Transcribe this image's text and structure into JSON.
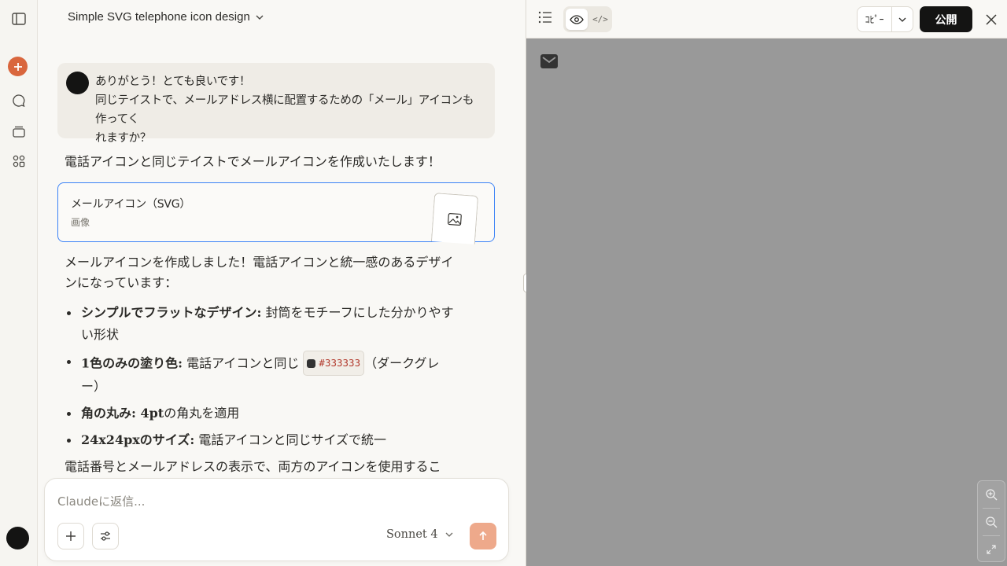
{
  "rail": {
    "icons": [
      "sidebar-toggle-icon",
      "new-chat-icon",
      "chats-icon",
      "projects-icon",
      "artifacts-icon"
    ]
  },
  "chat": {
    "title": "Simple SVG telephone icon design",
    "user_message": "ありがとう！とても良いです！\n同じテイストで、メールアドレス横に配置するための「メール」アイコンも作ってく\nれますか？",
    "assistant_intro": "電話アイコンと同じテイストでメールアイコンを作成いたします！",
    "artifact": {
      "title": "メールアイコン（SVG）",
      "subtitle": "画像"
    },
    "assistant_body_line1": "メールアイコンを作成しました！電話アイコンと統一感のあるデザイ",
    "assistant_body_line2": "ンになっています：",
    "bullets": [
      {
        "bold": "シンプルでフラットなデザイン:",
        "text": " 封筒をモチーフにした分かりやす",
        "text2": "い形状"
      },
      {
        "bold": "1色のみの塗り色:",
        "text": " 電話アイコンと同じ ",
        "code": "#333333",
        "text_after": "（ダークグレ",
        "text2": "ー）"
      },
      {
        "bold": "角の丸み: 4pt",
        "text": "の角丸を適用"
      },
      {
        "bold": "24x24pxのサイズ:",
        "text": " 電話アイコンと同じサイズで統一"
      }
    ],
    "assistant_outro": "電話番号とメールアドレスの表示で、両方のアイコンを使用するこ",
    "composer": {
      "placeholder": "Claudeに返信...",
      "model": "Sonnet 4"
    }
  },
  "preview": {
    "copy_label": "ｺﾋﾟｰ",
    "publish_label": "公開",
    "canvas_color": "#999999",
    "icon_color": "#333333"
  },
  "colors": {
    "accent": "#d9663d",
    "artifact_border": "#3b82f6",
    "send_button": "#eea98b"
  }
}
